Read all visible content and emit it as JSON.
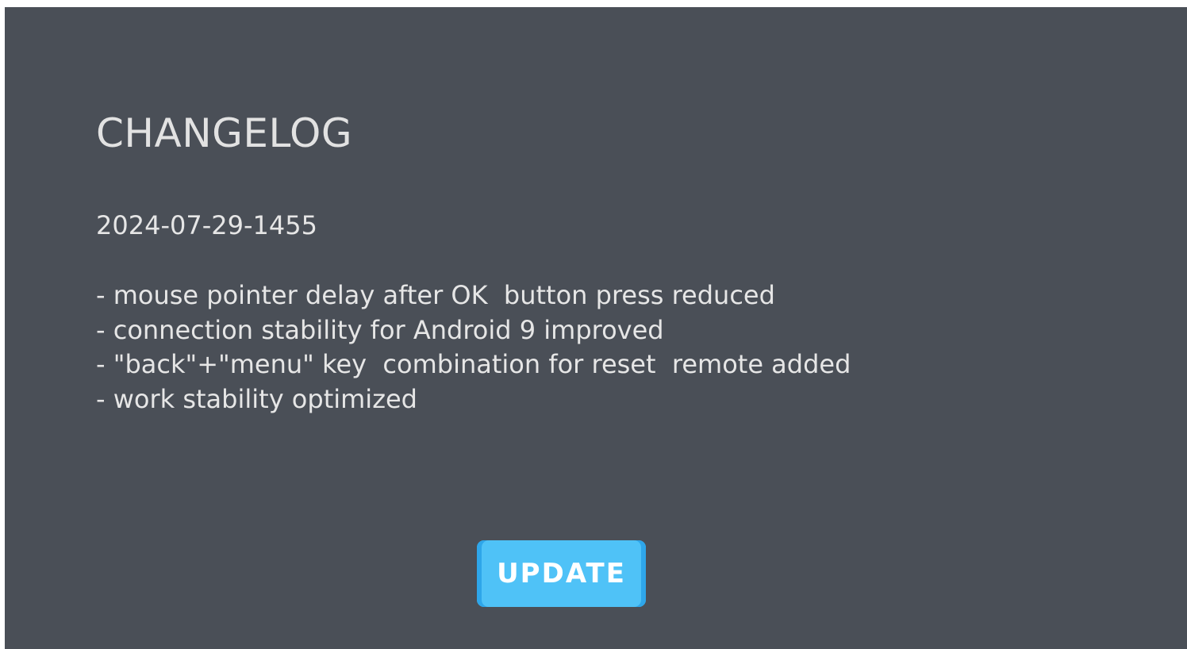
{
  "dialog": {
    "title": "CHANGELOG",
    "version": "2024-07-29-1455",
    "changes": [
      "- mouse pointer delay after OK  button press reduced",
      "- connection stability for Android 9 improved",
      "- \"back\"+\"menu\" key  combination for reset  remote added",
      "- work stability optimized"
    ],
    "update_label": "UPDATE"
  },
  "colors": {
    "background": "#4a4f57",
    "text": "#e6e6e6",
    "button": "#4fc2f7",
    "button_edge": "#2ea6ea"
  }
}
